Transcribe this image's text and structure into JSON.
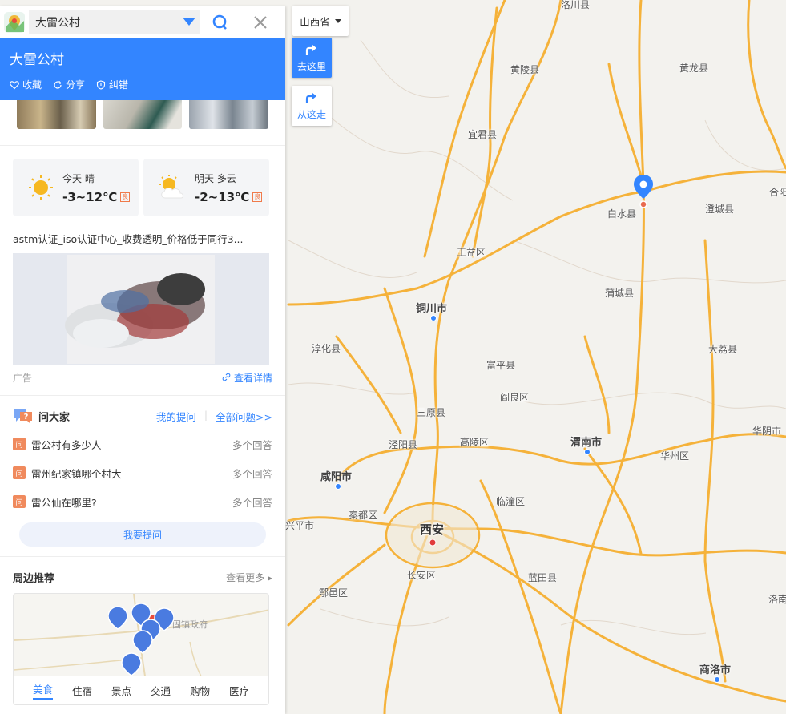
{
  "search": {
    "query": "大雷公村"
  },
  "place": {
    "title": "大雷公村",
    "actions": {
      "favorite": "收藏",
      "share": "分享",
      "report": "纠错"
    }
  },
  "weather": {
    "today": {
      "label": "今天  晴",
      "temp": "-3~12℃",
      "badge": "良"
    },
    "tomorrow": {
      "label": "明天  多云",
      "temp": "-2~13℃",
      "badge": "良"
    }
  },
  "ad": {
    "text": "astm认证_iso认证中心_收费透明_价格低于同行3...",
    "label": "广告",
    "link": "查看详情"
  },
  "qa": {
    "title": "问大家",
    "my_questions": "我的提问",
    "all_questions": "全部问题>>",
    "icon_text": "问",
    "items": [
      {
        "question": "雷公村有多少人",
        "answers": "多个回答"
      },
      {
        "question": "雷州纪家镇哪个村大",
        "answers": "多个回答"
      },
      {
        "question": "雷公仙在哪里?",
        "answers": "多个回答"
      }
    ],
    "ask_button": "我要提问"
  },
  "nearby": {
    "title": "周边推荐",
    "more": "查看更多",
    "map_label": "固镇政府",
    "tabs": [
      "美食",
      "住宿",
      "景点",
      "交通",
      "购物",
      "医疗"
    ],
    "active_tab": "美食"
  },
  "controls": {
    "province": "山西省",
    "go_here": "去这里",
    "from_here": "从这走"
  },
  "map_labels": {
    "luochuan": "洛川县",
    "huangling": "黄陵县",
    "huanglong": "黄龙县",
    "yijun": "宜君县",
    "baishui": "白水县",
    "chengcheng": "澄城县",
    "heyang": "合阳",
    "wangyi": "王益区",
    "pucheng": "蒲城县",
    "tongchuan": "铜川市",
    "chunhua": "淳化县",
    "fuping": "富平县",
    "dali": "大荔县",
    "yanliang": "阎良区",
    "sanyuan": "三原县",
    "jingyang": "泾阳县",
    "gaoling": "高陵区",
    "weinan": "渭南市",
    "huayin": "华阴市",
    "huazhou": "华州区",
    "xianyang": "咸阳市",
    "lintong": "临潼区",
    "qindu": "秦都区",
    "xingping": "兴平市",
    "xian": "西安",
    "changan": "长安区",
    "lantian": "蓝田县",
    "huyi": "鄠邑区",
    "luonan": "洛南",
    "shangluo": "商洛市"
  },
  "colors": {
    "accent": "#3385ff",
    "road": "#f5b23a",
    "marker": "#3385ff"
  }
}
